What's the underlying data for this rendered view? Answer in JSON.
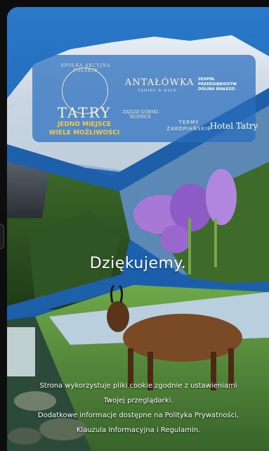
{
  "logos": {
    "tatry_badge_top": "SPOŁKA AKCYJNA POLSKIE",
    "tatry_brand": "TATRY",
    "tatry_tagline_1": "JEDNO MIEJSCE",
    "tatry_tagline_2": "WIELE MOŻLIWOŚCI",
    "antalowka": "ANTAŁÓWKA",
    "antalowka_sub": "TANIEC & BALE",
    "dolina_line1": "ZESPÓŁ",
    "dolina_line2": "PRZEDSIĘBIOSTW",
    "dolina_line3": "DOLINA BIAŁEGO",
    "zajazd": "ZAJAZD GÓRSKI KUŹNICE",
    "termy_line1": "TERMY",
    "termy_line2": "ZAKOPIAŃSKIE",
    "hotel": "Hotel Tatry"
  },
  "thanks": "Dziękujemy.",
  "cookie": {
    "line1": "Strona wykorzystuje pliki cookie zgodnie z ustawieniami",
    "line2": "Twojej przeglądarki.",
    "line3": "Dodatkowe informacje dostępne na Polityka Prywatności,",
    "line4": "Klauzula Informacyjna i Regulamin."
  },
  "colors": {
    "sky": "#1d5fa8",
    "gold": "#f6c944"
  }
}
